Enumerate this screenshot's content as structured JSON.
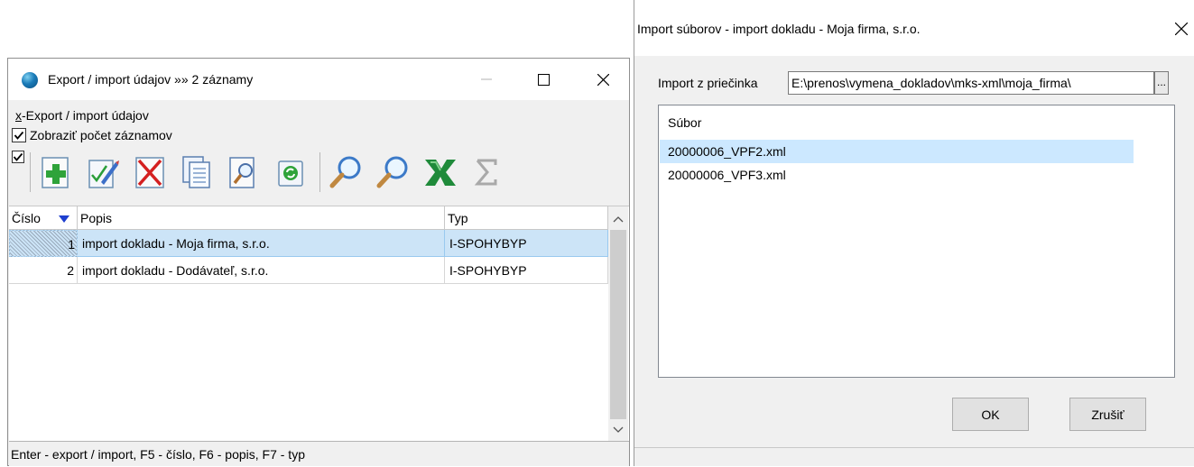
{
  "left_window": {
    "title": "Export / import údajov »» 2 záznamy",
    "menu_prefix": "x",
    "menu_rest": "-Export / import údajov",
    "show_count_label": "Zobraziť počet záznamov",
    "show_count_checked": true,
    "toolbar": [
      "add-icon",
      "edit-icon",
      "delete-icon",
      "copy-icon",
      "preview-icon",
      "refresh-icon",
      "search-icon",
      "search-next-icon",
      "excel-icon",
      "sum-icon"
    ],
    "grid": {
      "columns": [
        "Číslo",
        "Popis",
        "Typ"
      ],
      "rows": [
        {
          "cislo": "1",
          "popis": "import dokladu - Moja firma, s.r.o.",
          "typ": "I-SPOHYBYP"
        },
        {
          "cislo": "2",
          "popis": "import dokladu - Dodávateľ, s.r.o.",
          "typ": "I-SPOHYBYP"
        }
      ]
    },
    "status": "Enter - export / import, F5 - číslo, F6 - popis, F7 - typ"
  },
  "dialog": {
    "title": "Import súborov - import dokladu - Moja firma, s.r.o.",
    "folder_label": "Import z priečinka",
    "folder_value": "E:\\prenos\\vymena_dokladov\\mks-xml\\moja_firma\\",
    "browse_label": "...",
    "list_header": "Súbor",
    "files": [
      "20000006_VPF2.xml",
      "20000006_VPF3.xml"
    ],
    "ok_label": "OK",
    "cancel_label": "Zrušiť"
  },
  "colors": {
    "selection": "#cce4f7",
    "accent_sort": "#1e3fcf"
  }
}
